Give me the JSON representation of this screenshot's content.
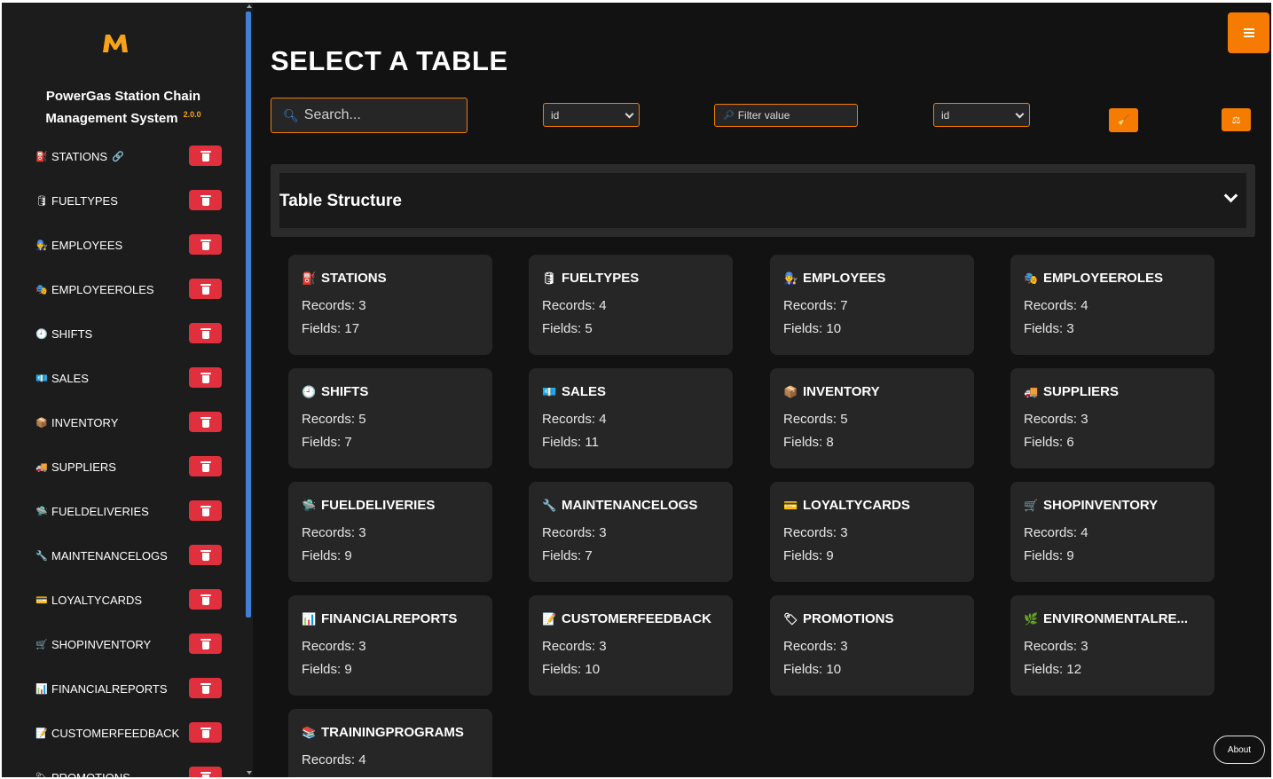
{
  "app": {
    "logo_letter": "M",
    "title_line1": "PowerGas Station Chain",
    "title_line2": "Management System",
    "version": "2.0.0",
    "brand_color": "#f57c00",
    "delete_color": "#e0303e"
  },
  "sidebar": {
    "items": [
      {
        "label": "STATIONS",
        "icon": "⛽",
        "icon_name": "fuel-pump-icon",
        "link": "🔗"
      },
      {
        "label": "FUELTYPES",
        "icon": "🛢",
        "icon_name": "barrel-icon"
      },
      {
        "label": "EMPLOYEES",
        "icon": "👨‍🔧",
        "icon_name": "worker-icon"
      },
      {
        "label": "EMPLOYEEROLES",
        "icon": "🎭",
        "icon_name": "masks-icon"
      },
      {
        "label": "SHIFTS",
        "icon": "🕘",
        "icon_name": "clock-icon"
      },
      {
        "label": "SALES",
        "icon": "💶",
        "icon_name": "money-icon"
      },
      {
        "label": "INVENTORY",
        "icon": "📦",
        "icon_name": "box-icon"
      },
      {
        "label": "SUPPLIERS",
        "icon": "🚚",
        "icon_name": "truck-icon"
      },
      {
        "label": "FUELDELIVERIES",
        "icon": "🛸",
        "icon_name": "delivery-icon"
      },
      {
        "label": "MAINTENANCELOGS",
        "icon": "🔧",
        "icon_name": "wrench-icon"
      },
      {
        "label": "LOYALTYCARDS",
        "icon": "💳",
        "icon_name": "card-icon"
      },
      {
        "label": "SHOPINVENTORY",
        "icon": "🛒",
        "icon_name": "cart-icon"
      },
      {
        "label": "FINANCIALREPORTS",
        "icon": "📊",
        "icon_name": "chart-icon"
      },
      {
        "label": "CUSTOMERFEEDBACK",
        "icon": "📝",
        "icon_name": "memo-icon"
      },
      {
        "label": "PROMOTIONS",
        "icon": "🏷",
        "icon_name": "tag-icon"
      }
    ]
  },
  "main": {
    "page_title": "SELECT A TABLE",
    "search_placeholder": "Search...",
    "select_field_1": "id",
    "filter_placeholder": "Filter value",
    "select_field_2": "id",
    "table_structure_label": "Table Structure",
    "about_label": "About"
  },
  "cards": [
    {
      "name": "STATIONS",
      "icon": "⛽",
      "icon_name": "fuel-pump-icon",
      "records": "Records: 3",
      "fields": "Fields: 17"
    },
    {
      "name": "FUELTYPES",
      "icon": "🛢",
      "icon_name": "barrel-icon",
      "records": "Records: 4",
      "fields": "Fields: 5"
    },
    {
      "name": "EMPLOYEES",
      "icon": "👨‍🔧",
      "icon_name": "worker-icon",
      "records": "Records: 7",
      "fields": "Fields: 10"
    },
    {
      "name": "EMPLOYEEROLES",
      "icon": "🎭",
      "icon_name": "masks-icon",
      "records": "Records: 4",
      "fields": "Fields: 3"
    },
    {
      "name": "SHIFTS",
      "icon": "🕘",
      "icon_name": "clock-icon",
      "records": "Records: 5",
      "fields": "Fields: 7"
    },
    {
      "name": "SALES",
      "icon": "💶",
      "icon_name": "money-icon",
      "records": "Records: 4",
      "fields": "Fields: 11"
    },
    {
      "name": "INVENTORY",
      "icon": "📦",
      "icon_name": "box-icon",
      "records": "Records: 5",
      "fields": "Fields: 8"
    },
    {
      "name": "SUPPLIERS",
      "icon": "🚚",
      "icon_name": "truck-icon",
      "records": "Records: 3",
      "fields": "Fields: 6"
    },
    {
      "name": "FUELDELIVERIES",
      "icon": "🛸",
      "icon_name": "delivery-icon",
      "records": "Records: 3",
      "fields": "Fields: 9"
    },
    {
      "name": "MAINTENANCELOGS",
      "icon": "🔧",
      "icon_name": "wrench-icon",
      "records": "Records: 3",
      "fields": "Fields: 7"
    },
    {
      "name": "LOYALTYCARDS",
      "icon": "💳",
      "icon_name": "card-icon",
      "records": "Records: 3",
      "fields": "Fields: 9"
    },
    {
      "name": "SHOPINVENTORY",
      "icon": "🛒",
      "icon_name": "cart-icon",
      "records": "Records: 4",
      "fields": "Fields: 9"
    },
    {
      "name": "FINANCIALREPORTS",
      "icon": "📊",
      "icon_name": "chart-icon",
      "records": "Records: 3",
      "fields": "Fields: 9"
    },
    {
      "name": "CUSTOMERFEEDBACK",
      "icon": "📝",
      "icon_name": "memo-icon",
      "records": "Records: 3",
      "fields": "Fields: 10"
    },
    {
      "name": "PROMOTIONS",
      "icon": "🏷",
      "icon_name": "tag-icon",
      "records": "Records: 3",
      "fields": "Fields: 10"
    },
    {
      "name": "ENVIRONMENTALRE...",
      "icon": "🌿",
      "icon_name": "leaf-icon",
      "records": "Records: 3",
      "fields": "Fields: 12"
    },
    {
      "name": "TRAININGPROGRAMS",
      "icon": "📚",
      "icon_name": "books-icon",
      "records": "Records: 4",
      "fields": ""
    }
  ]
}
